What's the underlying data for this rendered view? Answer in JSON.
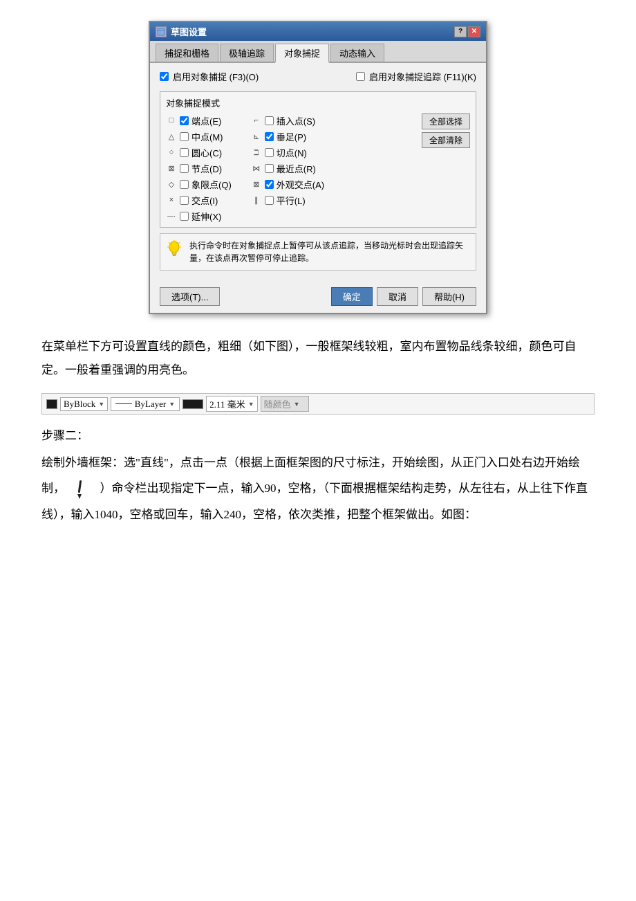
{
  "dialog": {
    "title": "草图设置",
    "tabs": [
      "捕捉和栅格",
      "极轴追踪",
      "对象捕捉",
      "动态输入"
    ],
    "active_tab": "对象捕捉",
    "enable_snap_label": "启用对象捕捉 (F3)(O)",
    "enable_tracking_label": "启用对象捕捉追踪 (F11)(K)",
    "snap_modes_title": "对象捕捉模式",
    "snap_modes": [
      {
        "icon": "□",
        "checked": true,
        "label": "端点(E)"
      },
      {
        "icon": "△",
        "checked": false,
        "label": "中点(M)"
      },
      {
        "icon": "○",
        "checked": false,
        "label": "圆心(C)"
      },
      {
        "icon": "⊠",
        "checked": false,
        "label": "节点(D)"
      },
      {
        "icon": "◇",
        "checked": false,
        "label": "象限点(Q)"
      },
      {
        "icon": "×",
        "checked": false,
        "label": "交点(I)"
      },
      {
        "icon": "—·",
        "checked": false,
        "label": "延伸(X)"
      }
    ],
    "snap_modes_right": [
      {
        "icon": "⌐",
        "checked": false,
        "label": "插入点(S)"
      },
      {
        "icon": "⊾",
        "checked": true,
        "label": "垂足(P)"
      },
      {
        "icon": "ℶ",
        "checked": false,
        "label": "切点(N)"
      },
      {
        "icon": "⋈",
        "checked": false,
        "label": "最近点(R)"
      },
      {
        "icon": "⊠",
        "checked": true,
        "label": "外观交点(A)"
      },
      {
        "icon": "∥",
        "checked": false,
        "label": "平行(L)"
      }
    ],
    "btn_select_all": "全部选择",
    "btn_clear_all": "全部清除",
    "info_text": "执行命令时在对象捕捉点上暂停可从该点追踪，当移动光标时会出现追踪矢量，在该点再次暂停可停止追踪。",
    "btn_options": "选项(T)...",
    "btn_ok": "确定",
    "btn_cancel": "取消",
    "btn_help": "帮助(H)"
  },
  "body_text_1": "在菜单栏下方可设置直线的颜色，粗细（如下图），一般框架线较粗，室内布置物品线条较细，颜色可自定。一般着重强调的用亮色。",
  "toolbar": {
    "color_label": "ByBlock",
    "line_label": "ByLayer",
    "size_label": "2.11 毫米",
    "color2_label": "随颜色"
  },
  "step_two_title": "步骤二：",
  "step_two_text1": "绘制外墙框架：选\"直线\"，点击一点（根据上面框架图的尺寸标注，开始绘图，从正门入口处右边开始绘制，",
  "step_two_text2": "）命令栏出现指定下一点，输入90，空格，（下面根据框架结构走势，从左往右，从上往下作直线），输入1040，空格或回车，输入240，空格，依次类推，把整个框架做出。如图："
}
